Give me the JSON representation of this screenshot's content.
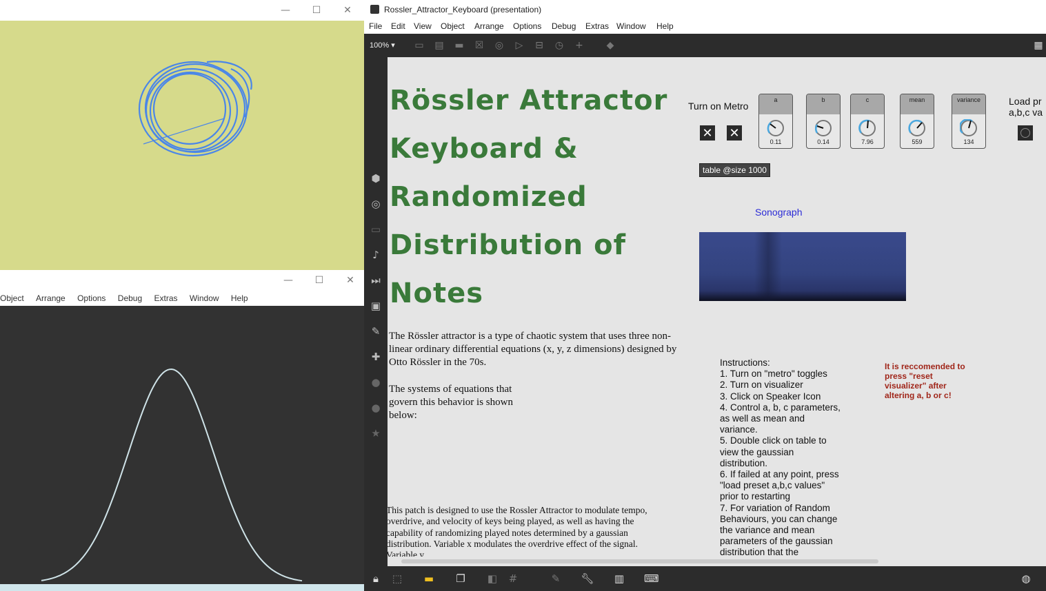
{
  "left_top_window": {
    "controls": {
      "minimize": "—",
      "maximize": "☐",
      "close": "✕"
    },
    "attractor_color": "#4a86e8",
    "background_color": "#d6da8b"
  },
  "left_bottom_window": {
    "controls": {
      "minimize": "—",
      "maximize": "☐",
      "close": "✕"
    },
    "menu": [
      "Object",
      "Arrange",
      "Options",
      "Debug",
      "Extras",
      "Window",
      "Help"
    ],
    "curve_color": "#cfe3e8"
  },
  "main_window": {
    "title": "Rossler_Attractor_Keyboard (presentation)",
    "menu": [
      "File",
      "Edit",
      "View",
      "Object",
      "Arrange",
      "Options",
      "Debug",
      "Extras",
      "Window",
      "Help"
    ],
    "zoom": "100%",
    "heading_lines": [
      "Rössler Attractor",
      "Keyboard &",
      "Randomized",
      "Distribution of",
      "Notes"
    ],
    "intro_paragraph": "The Rössler attractor is a type of chaotic system that uses three non-linear ordinary differential equations (x, y, z dimensions) designed by Otto Rössler in the 70s.",
    "equations_paragraph": "The systems of equations that govern this behavior is shown below:",
    "patch_paragraph": "This patch is designed to use the Rossler Attractor to modulate tempo, overdrive, and velocity of keys being played, as well as having the capability of randomizing played notes determined by a gaussian distribution. Variable x modulates the overdrive effect of the signal. Variable y",
    "turn_on_metro_label": "Turn on Metro",
    "dials": [
      {
        "label": "a",
        "value": "0.11"
      },
      {
        "label": "b",
        "value": "0.14"
      },
      {
        "label": "c",
        "value": "7.96"
      },
      {
        "label": "mean",
        "value": "559"
      },
      {
        "label": "variance",
        "value": "134"
      }
    ],
    "load_preset_label": "Load pr\na,b,c va",
    "table_object": "table @size 1000",
    "sonograph_label": "Sonograph",
    "instructions": [
      "Instructions:",
      "1. Turn on \"metro\" toggles",
      "2. Turn on visualizer",
      "3. Click on Speaker Icon",
      "4. Control a, b, c parameters,",
      "as well as mean and",
      "variance.",
      "5. Double click on table to",
      "view the gaussian",
      "distribution.",
      "6. If failed at any point, press",
      "\"load preset a,b,c values\"",
      "prior to restarting",
      "7. For variation of Random",
      "Behaviours, you can change",
      "the variance and mean",
      "parameters of the gaussian",
      "distribution that the"
    ],
    "recommendation": "It is reccomended to press \"reset visualizer\" after altering a, b or c!",
    "colors": {
      "heading": "#3a7a3a",
      "recommendation": "#a0261a",
      "sonograph_label": "#2b2bd6",
      "toolbar_bg": "#2c2c2c",
      "dial_accent": "#4aa8e0"
    }
  }
}
